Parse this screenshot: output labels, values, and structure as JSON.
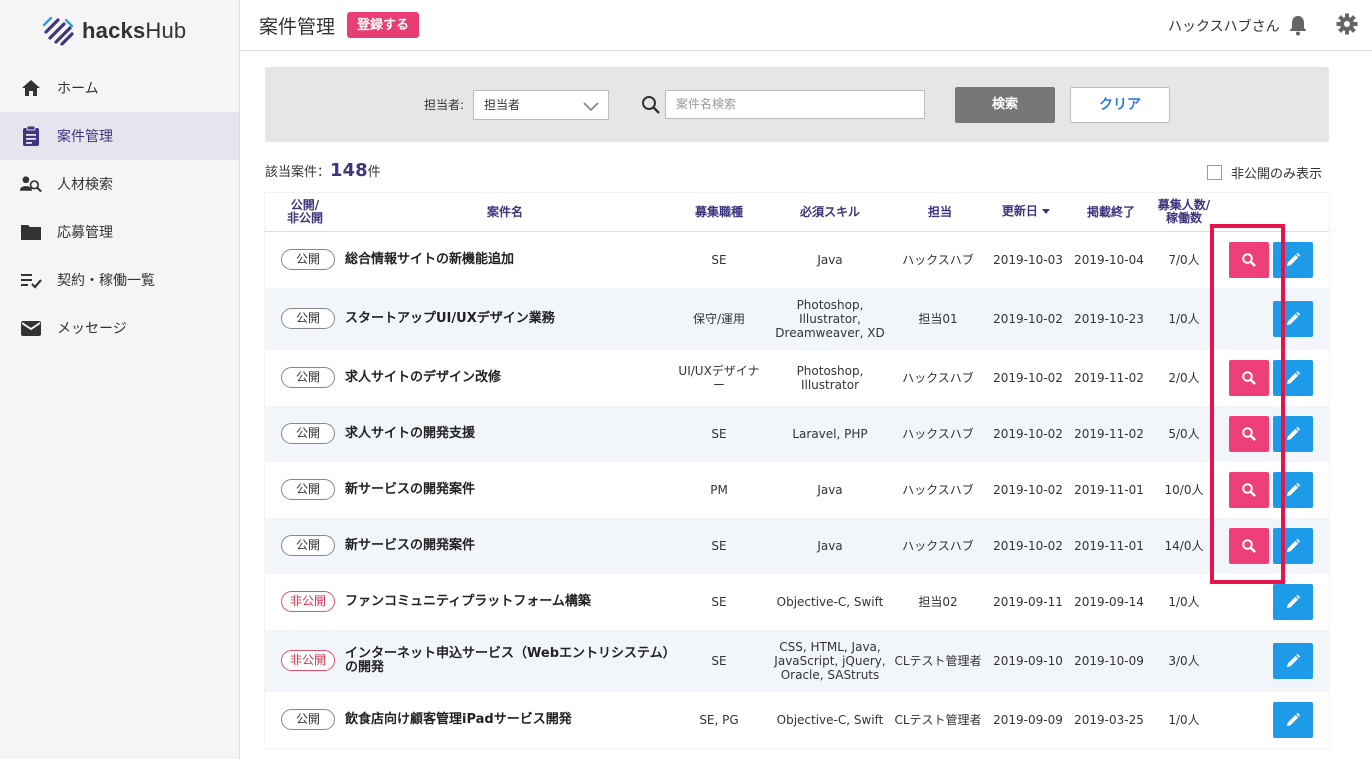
{
  "app": {
    "logo_bold": "hacks",
    "logo_thin": "Hub"
  },
  "sidebar": {
    "items": [
      {
        "label": "ホーム",
        "icon": "home-icon"
      },
      {
        "label": "案件管理",
        "icon": "clipboard-icon"
      },
      {
        "label": "人材検索",
        "icon": "person-search-icon"
      },
      {
        "label": "応募管理",
        "icon": "folder-icon"
      },
      {
        "label": "契約・稼働一覧",
        "icon": "list-check-icon"
      },
      {
        "label": "メッセージ",
        "icon": "mail-icon"
      }
    ]
  },
  "header": {
    "title": "案件管理",
    "register_label": "登録する",
    "user_name": "ハックスハブさん"
  },
  "filter": {
    "owner_label": "担当者:",
    "owner_selected": "担当者",
    "search_placeholder": "案件名検索",
    "search_button": "検索",
    "clear_button": "クリア"
  },
  "results": {
    "prefix": "該当案件：",
    "count": "148",
    "suffix": "件",
    "private_only_label": "非公開のみ表示"
  },
  "table": {
    "headers": {
      "status": "公開/\n非公開",
      "title": "案件名",
      "role": "募集職種",
      "skills": "必須スキル",
      "owner": "担当",
      "updated": "更新日",
      "end": "掲載終了",
      "count": "募集人数/\n稼働数"
    },
    "rows": [
      {
        "status": "公開",
        "title": "総合情報サイトの新機能追加",
        "role": "SE",
        "skills": "Java",
        "owner": "ハックスハブ",
        "updated": "2019-10-03",
        "end": "2019-10-04",
        "count": "7/0人",
        "view": true
      },
      {
        "status": "公開",
        "title": "スタートアップUI/UXデザイン業務",
        "role": "保守/運用",
        "skills": "Photoshop,\nIllustrator,\nDreamweaver, XD",
        "owner": "担当01",
        "updated": "2019-10-02",
        "end": "2019-10-23",
        "count": "1/0人",
        "view": false
      },
      {
        "status": "公開",
        "title": "求人サイトのデザイン改修",
        "role": "UI/UXデザイナ\nー",
        "skills": "Photoshop,\nIllustrator",
        "owner": "ハックスハブ",
        "updated": "2019-10-02",
        "end": "2019-11-02",
        "count": "2/0人",
        "view": true
      },
      {
        "status": "公開",
        "title": "求人サイトの開発支援",
        "role": "SE",
        "skills": "Laravel, PHP",
        "owner": "ハックスハブ",
        "updated": "2019-10-02",
        "end": "2019-11-02",
        "count": "5/0人",
        "view": true
      },
      {
        "status": "公開",
        "title": "新サービスの開発案件",
        "role": "PM",
        "skills": "Java",
        "owner": "ハックスハブ",
        "updated": "2019-10-02",
        "end": "2019-11-01",
        "count": "10/0人",
        "view": true
      },
      {
        "status": "公開",
        "title": "新サービスの開発案件",
        "role": "SE",
        "skills": "Java",
        "owner": "ハックスハブ",
        "updated": "2019-10-02",
        "end": "2019-11-01",
        "count": "14/0人",
        "view": true
      },
      {
        "status": "非公開",
        "title": "ファンコミュニティプラットフォーム構築",
        "role": "SE",
        "skills": "Objective-C, Swift",
        "owner": "担当02",
        "updated": "2019-09-11",
        "end": "2019-09-14",
        "count": "1/0人",
        "view": false
      },
      {
        "status": "非公開",
        "title": "インターネット申込サービス（Webエントリシステム）\nの開発",
        "role": "SE",
        "skills": "CSS, HTML, Java,\nJavaScript, jQuery,\nOracle, SAStruts",
        "owner": "CLテスト管理者",
        "updated": "2019-09-10",
        "end": "2019-10-09",
        "count": "3/0人",
        "view": false
      },
      {
        "status": "公開",
        "title": "飲食店向け顧客管理iPadサービス開発",
        "role": "SE, PG",
        "skills": "Objective-C, Swift",
        "owner": "CLテスト管理者",
        "updated": "2019-09-09",
        "end": "2019-03-25",
        "count": "1/0人",
        "view": false
      }
    ]
  },
  "colors": {
    "accent": "#3d3580",
    "pink": "#ee3f78",
    "blue": "#1e9be8",
    "highlight": "#e8134a"
  }
}
